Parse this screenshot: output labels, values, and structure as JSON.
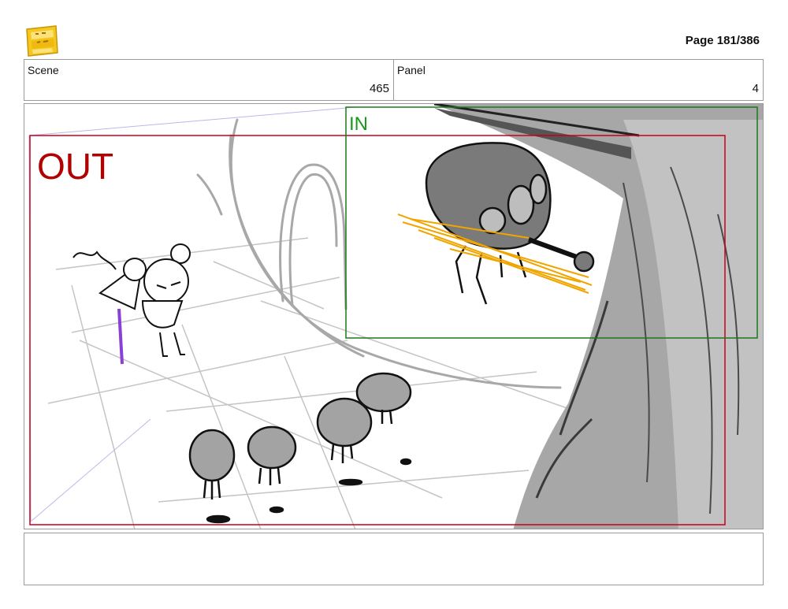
{
  "logo": {
    "icon": "young-jedi-adventures-logo-icon",
    "color": "#f2c61f"
  },
  "header": {
    "page": "Page 181/386"
  },
  "info": {
    "scene_label": "Scene",
    "scene_value": "465",
    "panel_label": "Panel",
    "panel_value": "4"
  },
  "panel": {
    "out_label": "OUT",
    "in_label": "IN",
    "out_color": "#b00000",
    "in_color": "#1a9a1a"
  },
  "notes": {
    "text": ""
  }
}
